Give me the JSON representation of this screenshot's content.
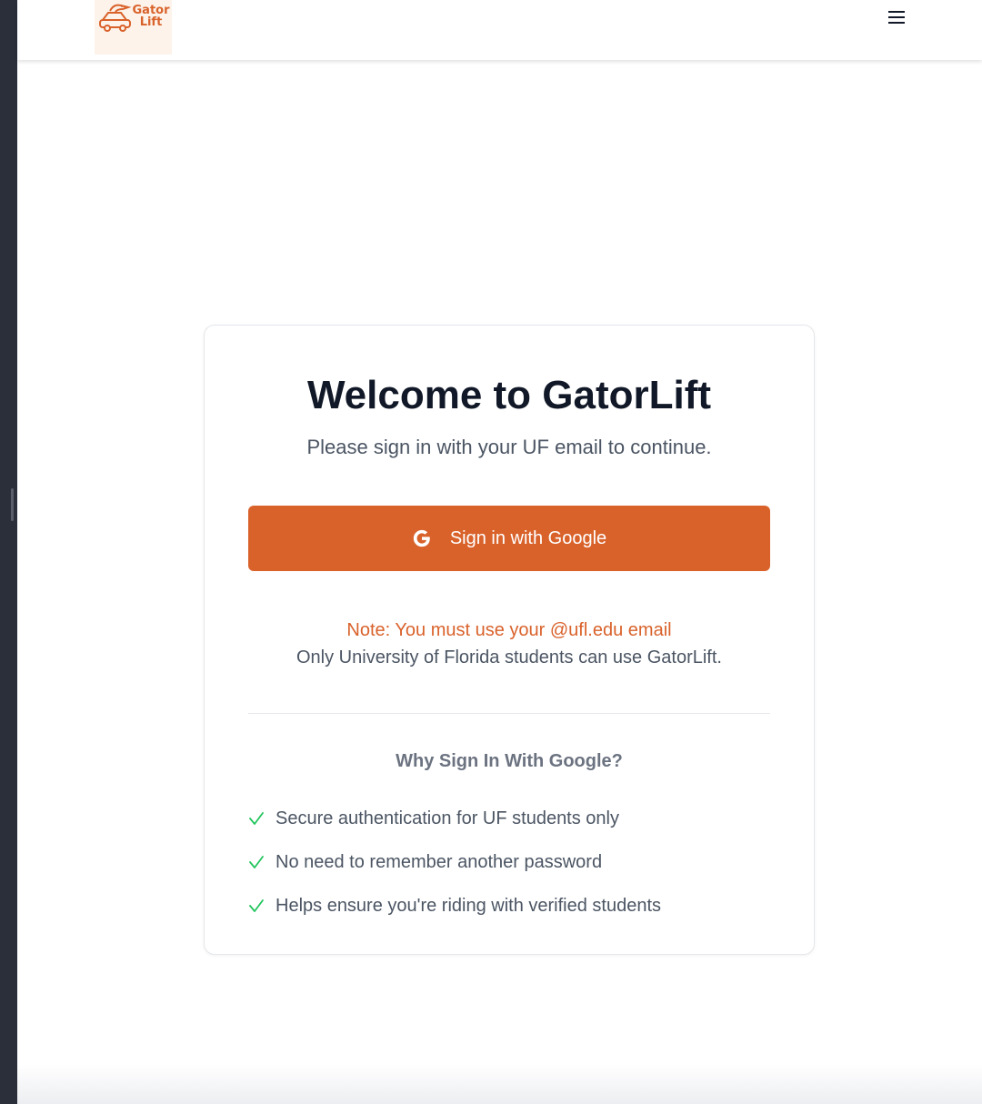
{
  "app": {
    "logo_text_line1": "Gator",
    "logo_text_line2": "Lift",
    "menu_icon": "hamburger-menu-icon"
  },
  "colors": {
    "brand_orange": "#d9622b",
    "title": "#111827",
    "body_text": "#4b5563",
    "muted_text": "#6b7280",
    "check_green": "#22c55e"
  },
  "signin": {
    "title": "Welcome to GatorLift",
    "subtitle": "Please sign in with your UF email to continue.",
    "button_label": "Sign in with Google",
    "button_icon": "google-icon",
    "note": "Note: You must use your @ufl.edu email",
    "note_sub": "Only University of Florida students can use GatorLift.",
    "why_title": "Why Sign In With Google?",
    "benefits": [
      "Secure authentication for UF students only",
      "No need to remember another password",
      "Helps ensure you're riding with verified students"
    ]
  }
}
